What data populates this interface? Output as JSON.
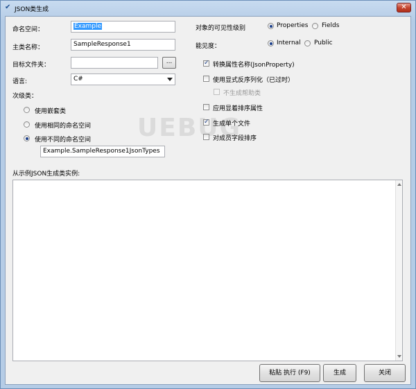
{
  "window": {
    "title": "JSON类生成",
    "close_glyph": "✕"
  },
  "form": {
    "namespace_label": "命名空间：",
    "namespace_value": "Example",
    "main_class_label": "主类名称：",
    "main_class_value": "SampleResponse1",
    "target_folder_label": "目标文件夹：",
    "target_folder_value": "",
    "browse_label": "...",
    "language_label": "语言:",
    "language_value": "C#",
    "subclass_label": "次级类：",
    "subclass_options": [
      {
        "label": "使用嵌套类",
        "selected": false
      },
      {
        "label": "使用相同的命名空间",
        "selected": false
      },
      {
        "label": "使用不同的命名空间",
        "selected": true
      }
    ],
    "subnamespace_value": "Example.SampleResponse1JsonTypes"
  },
  "options": {
    "visibility_label": "对象的可见性级别",
    "visibility_options": [
      {
        "label": "Properties",
        "selected": true
      },
      {
        "label": "Fields",
        "selected": false
      }
    ],
    "access_label": "能见度：",
    "access_options": [
      {
        "label": "Internal",
        "selected": true
      },
      {
        "label": "Public",
        "selected": false
      }
    ],
    "checkboxes": [
      {
        "label": "转换属性名称(JsonProperty)",
        "checked": true,
        "disabled": false
      },
      {
        "label": "使用显式反序列化（已过时）",
        "checked": false,
        "disabled": false
      },
      {
        "label": "不生成帮助类",
        "checked": false,
        "disabled": true
      },
      {
        "label": "应用显着排序属性",
        "checked": false,
        "disabled": false
      },
      {
        "label": "生成单个文件",
        "checked": true,
        "disabled": false
      },
      {
        "label": "对成员字段排序",
        "checked": false,
        "disabled": false
      }
    ]
  },
  "sample": {
    "label": "从示例JSON生成类实例:",
    "value": ""
  },
  "buttons": {
    "paste_execute": "粘贴 执行 (F9)",
    "generate": "生成",
    "close": "关闭"
  },
  "watermark": "UEBUG"
}
